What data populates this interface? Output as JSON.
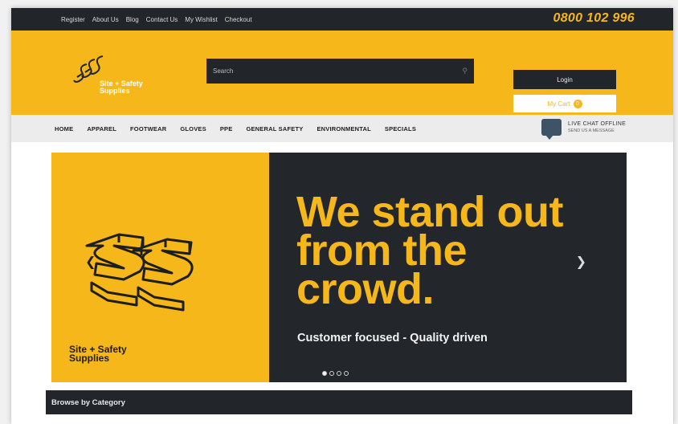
{
  "topbar": {
    "links": [
      "Register",
      "About Us",
      "Blog",
      "Contact Us",
      "My Wishlist",
      "Checkout"
    ],
    "phone": "0800 102 996"
  },
  "header": {
    "logo_text": "Site + Safety Supplies",
    "search_placeholder": "Search",
    "login_label": "Login",
    "cart_label": "My Cart",
    "cart_count": "0"
  },
  "nav": {
    "items": [
      "HOME",
      "APPAREL",
      "FOOTWEAR",
      "GLOVES",
      "PPE",
      "GENERAL SAFETY",
      "ENVIRONMENTAL",
      "SPECIALS"
    ],
    "live_chat_title": "LIVE CHAT OFFLINE",
    "live_chat_sub": "SEND US A MESSAGE"
  },
  "hero": {
    "logo_text": "Site + Safety Supplies",
    "headline": "We stand out from the crowd.",
    "tagline": "Customer focused - Quality driven",
    "slide_count": 4,
    "active_slide": 1
  },
  "browse": {
    "title": "Browse by Category"
  },
  "colors": {
    "brand_yellow": "#f5b719",
    "dark": "#222529",
    "nav_bg": "#ececec"
  }
}
